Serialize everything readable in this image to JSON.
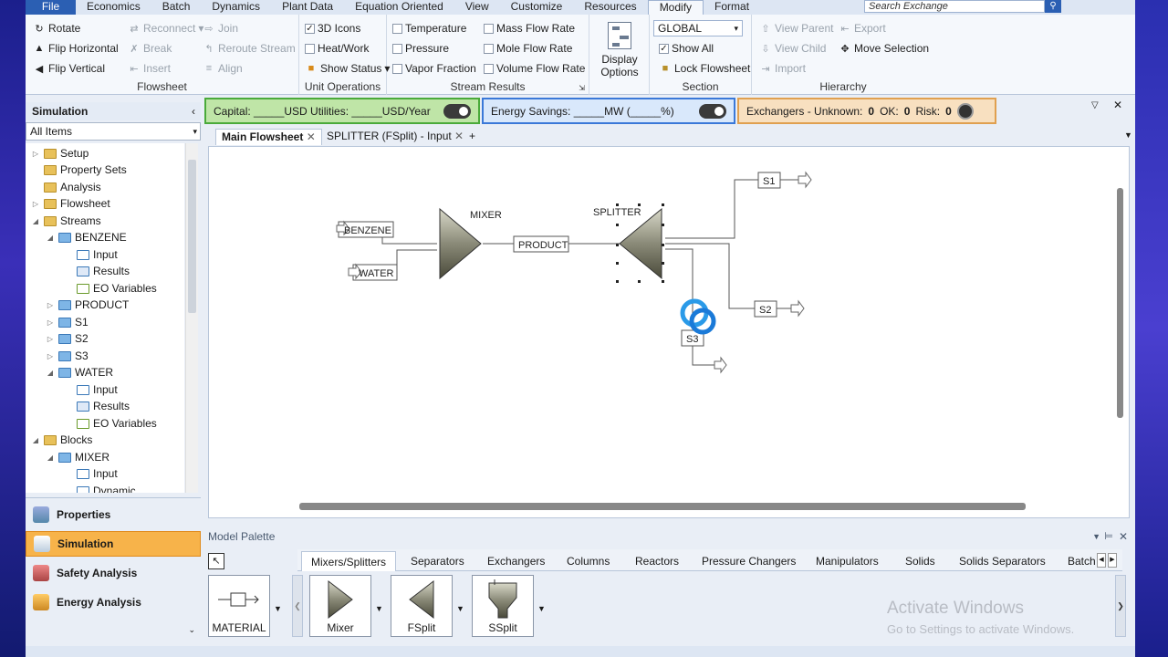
{
  "menu": [
    "File",
    "Economics",
    "Batch",
    "Dynamics",
    "Plant Data",
    "Equation Oriented",
    "View",
    "Customize",
    "Resources",
    "Modify",
    "Format"
  ],
  "search_placeholder": "Search Exchange",
  "ribbon": {
    "flowsheet": {
      "label": "Flowsheet",
      "rotate": "Rotate",
      "flip_h": "Flip Horizontal",
      "flip_v": "Flip Vertical",
      "reconnect": "Reconnect",
      "break": "Break",
      "insert": "Insert",
      "join": "Join",
      "reroute": "Reroute Stream",
      "align": "Align"
    },
    "unitops": {
      "label": "Unit Operations",
      "icons3d": "3D Icons",
      "heatwork": "Heat/Work",
      "showstatus": "Show Status"
    },
    "stream": {
      "label": "Stream Results",
      "temperature": "Temperature",
      "pressure": "Pressure",
      "vapor": "Vapor Fraction",
      "massflow": "Mass Flow Rate",
      "moleflow": "Mole Flow Rate",
      "volflow": "Volume Flow Rate"
    },
    "display": {
      "label": "Display Options"
    },
    "section": {
      "label": "Section",
      "value": "GLOBAL",
      "showall": "Show All",
      "lock": "Lock Flowsheet"
    },
    "hierarchy": {
      "label": "Hierarchy",
      "viewparent": "View Parent",
      "viewchild": "View Child",
      "import": "Import",
      "export": "Export",
      "movesel": "Move Selection"
    }
  },
  "left": {
    "title": "Simulation",
    "filter": "All Items",
    "tree": [
      {
        "label": "Setup"
      },
      {
        "label": "Property Sets"
      },
      {
        "label": "Analysis"
      },
      {
        "label": "Flowsheet"
      },
      {
        "label": "Streams"
      },
      {
        "label": "BENZENE"
      },
      {
        "label": "Input"
      },
      {
        "label": "Results"
      },
      {
        "label": "EO Variables"
      },
      {
        "label": "PRODUCT"
      },
      {
        "label": "S1"
      },
      {
        "label": "S2"
      },
      {
        "label": "S3"
      },
      {
        "label": "WATER"
      },
      {
        "label": "Input"
      },
      {
        "label": "Results"
      },
      {
        "label": "EO Variables"
      },
      {
        "label": "Blocks"
      },
      {
        "label": "MIXER"
      },
      {
        "label": "Input"
      },
      {
        "label": "Dynamic"
      }
    ],
    "nav": {
      "properties": "Properties",
      "simulation": "Simulation",
      "safety": "Safety Analysis",
      "energy": "Energy Analysis"
    }
  },
  "status": {
    "capital": "Capital: _____USD   Utilities: _____USD/Year",
    "energy": "Energy Savings: _____MW    (_____%)",
    "exch_label": "Exchangers -   Unknown:",
    "unknown": "0",
    "ok_label": "OK:",
    "ok": "0",
    "risk_label": "Risk:",
    "risk": "0"
  },
  "tabs": {
    "main": "Main Flowsheet",
    "splitter": "SPLITTER (FSplit) - Input"
  },
  "flowsheet": {
    "benzene": "BENZENE",
    "water": "WATER",
    "mixer": "MIXER",
    "product": "PRODUCT",
    "splitter": "SPLITTER",
    "s1": "S1",
    "s2": "S2",
    "s3": "S3"
  },
  "palette": {
    "title": "Model Palette",
    "tabs": [
      "Mixers/Splitters",
      "Separators",
      "Exchangers",
      "Columns",
      "Reactors",
      "Pressure Changers",
      "Manipulators",
      "Solids",
      "Solids Separators",
      "Batch I"
    ],
    "items": {
      "material": "MATERIAL",
      "mixer": "Mixer",
      "fsplit": "FSplit",
      "ssplit": "SSplit"
    }
  },
  "watermark": {
    "line1": "Activate Windows",
    "line2": "Go to Settings to activate Windows."
  }
}
